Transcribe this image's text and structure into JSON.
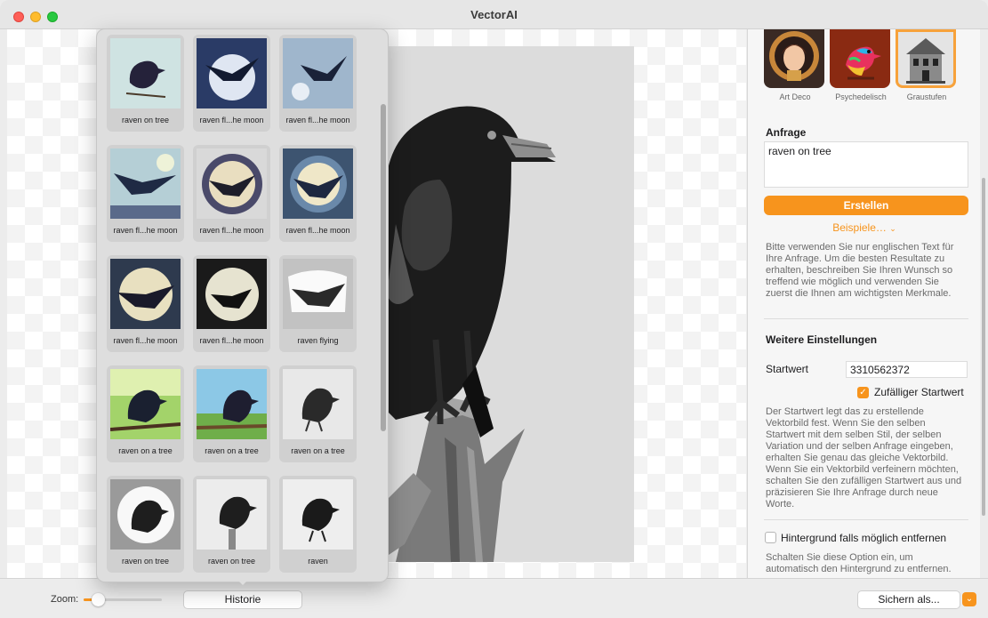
{
  "window": {
    "title": "VectorAI"
  },
  "styles": [
    {
      "label": "Art Deco",
      "selected": false
    },
    {
      "label": "Psychedelisch",
      "selected": false
    },
    {
      "label": "Graustufen",
      "selected": true
    }
  ],
  "prompt": {
    "heading": "Anfrage",
    "value": "raven on tree"
  },
  "create_button": "Erstellen",
  "examples_link": "Beispiele…",
  "prompt_help": "Bitte verwenden Sie nur englischen Text für Ihre Anfrage. Um die besten Resultate zu erhalten, beschreiben Sie Ihren Wunsch so treffend wie möglich und verwenden Sie zuerst die Ihnen am wichtigsten Merkmale.",
  "more_settings": {
    "heading": "Weitere Einstellungen",
    "seed_label": "Startwert",
    "seed_value": "3310562372",
    "random_seed_label": "Zufälliger Startwert",
    "random_seed_checked": true,
    "seed_help": "Der Startwert legt das zu erstellende Vektorbild fest. Wenn Sie den selben Startwert mit dem selben Stil, der selben Variation und der selben Anfrage eingeben, erhalten Sie genau das gleiche Vektorbild. Wenn Sie ein Vektorbild verfeinern möchten, schalten Sie den zufälligen Startwert aus und präzisieren Sie Ihre Anfrage durch neue Worte.",
    "remove_bg_label": "Hintergrund falls möglich entfernen",
    "remove_bg_checked": false,
    "remove_bg_help": "Schalten Sie diese Option ein, um automatisch den Hintergrund zu entfernen."
  },
  "history": [
    {
      "label": "raven on tree"
    },
    {
      "label": "raven fl...he moon"
    },
    {
      "label": "raven fl...he moon"
    },
    {
      "label": "raven fl...he moon"
    },
    {
      "label": "raven fl...he moon"
    },
    {
      "label": "raven fl...he moon"
    },
    {
      "label": "raven fl...he moon"
    },
    {
      "label": "raven fl...he moon"
    },
    {
      "label": "raven flying"
    },
    {
      "label": "raven on a tree"
    },
    {
      "label": "raven on a tree"
    },
    {
      "label": "raven on a tree"
    },
    {
      "label": "raven on tree"
    },
    {
      "label": "raven on tree"
    },
    {
      "label": "raven"
    }
  ],
  "bottom": {
    "zoom_label": "Zoom:",
    "zoom_level": 0.1,
    "history_button": "Historie",
    "save_button": "Sichern als..."
  },
  "colors": {
    "accent": "#f7941d"
  }
}
